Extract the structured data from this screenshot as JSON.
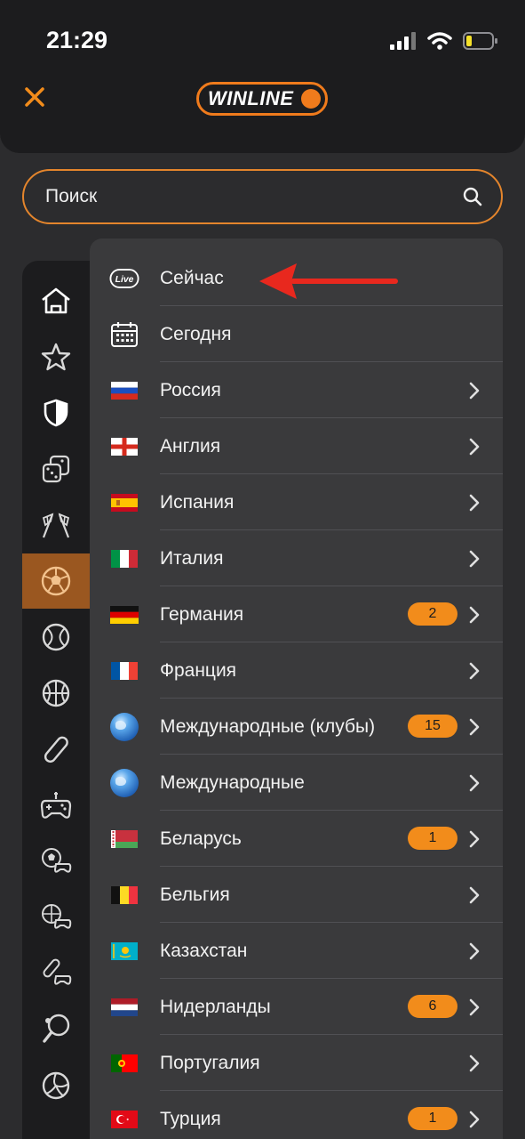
{
  "status": {
    "time": "21:29"
  },
  "header": {
    "logo_text": "WINLINE",
    "close_icon": "close-icon"
  },
  "search": {
    "placeholder": "Поиск",
    "value": ""
  },
  "sidebar": {
    "items": [
      {
        "icon": "home-icon",
        "active": false
      },
      {
        "icon": "star-icon",
        "active": false
      },
      {
        "icon": "shield-icon",
        "active": false
      },
      {
        "icon": "dice-icon",
        "active": false
      },
      {
        "icon": "racing-flags-icon",
        "active": false
      },
      {
        "icon": "football-icon",
        "active": true
      },
      {
        "icon": "tennis-icon",
        "active": false
      },
      {
        "icon": "basketball-icon",
        "active": false
      },
      {
        "icon": "hockey-puck-icon",
        "active": false
      },
      {
        "icon": "gamepad-icon",
        "active": false
      },
      {
        "icon": "esports-football-icon",
        "active": false
      },
      {
        "icon": "esports-basketball-icon",
        "active": false
      },
      {
        "icon": "esports-hockey-icon",
        "active": false
      },
      {
        "icon": "table-tennis-icon",
        "active": false
      },
      {
        "icon": "volleyball-icon",
        "active": false
      }
    ]
  },
  "menu": {
    "items": [
      {
        "label": "Сейчас",
        "icon": "live-icon",
        "badge": "",
        "chevron": false
      },
      {
        "label": "Сегодня",
        "icon": "calendar-icon",
        "badge": "",
        "chevron": false
      },
      {
        "label": "Россия",
        "icon": "flag-russia",
        "badge": "",
        "chevron": true
      },
      {
        "label": "Англия",
        "icon": "flag-england",
        "badge": "",
        "chevron": true
      },
      {
        "label": "Испания",
        "icon": "flag-spain",
        "badge": "",
        "chevron": true
      },
      {
        "label": "Италия",
        "icon": "flag-italy",
        "badge": "",
        "chevron": true
      },
      {
        "label": "Германия",
        "icon": "flag-germany",
        "badge": "2",
        "chevron": true
      },
      {
        "label": "Франция",
        "icon": "flag-france",
        "badge": "",
        "chevron": true
      },
      {
        "label": "Международные (клубы)",
        "icon": "globe-icon",
        "badge": "15",
        "chevron": true
      },
      {
        "label": "Международные",
        "icon": "globe-icon",
        "badge": "",
        "chevron": true
      },
      {
        "label": "Беларусь",
        "icon": "flag-belarus",
        "badge": "1",
        "chevron": true
      },
      {
        "label": "Бельгия",
        "icon": "flag-belgium",
        "badge": "",
        "chevron": true
      },
      {
        "label": "Казахстан",
        "icon": "flag-kazakhstan",
        "badge": "",
        "chevron": true
      },
      {
        "label": "Нидерланды",
        "icon": "flag-netherlands",
        "badge": "6",
        "chevron": true
      },
      {
        "label": "Португалия",
        "icon": "flag-portugal",
        "badge": "",
        "chevron": true
      },
      {
        "label": "Турция",
        "icon": "flag-turkey",
        "badge": "1",
        "chevron": true
      }
    ]
  },
  "colors": {
    "accent": "#f28c1b",
    "active_sidebar": "#9a5720",
    "background": "#2c2c2e",
    "panel": "#3a3a3c",
    "arrow": "#e8281e"
  }
}
